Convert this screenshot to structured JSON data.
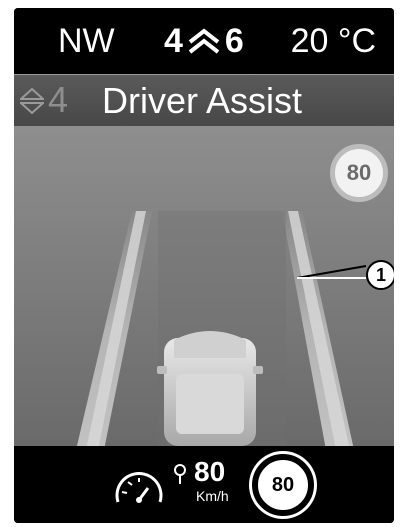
{
  "status_bar": {
    "heading": "NW",
    "gear_current": "4",
    "gear_next": "6",
    "temperature": "20 °C"
  },
  "display": {
    "mode_number": "4",
    "title": "Driver Assist",
    "speed_limit_sign": "80",
    "callout_number": "1"
  },
  "bottom_bar": {
    "set_speed": "80",
    "speed_unit": "Km/h",
    "speed_limit": "80"
  },
  "icons": [
    "up-down-arrows-icon",
    "gear-up-arrow-icon",
    "speed-limiter-gauge-icon"
  ],
  "colors": {
    "background": "#000000",
    "screen": "#7c7c7c",
    "text": "#ffffff"
  }
}
